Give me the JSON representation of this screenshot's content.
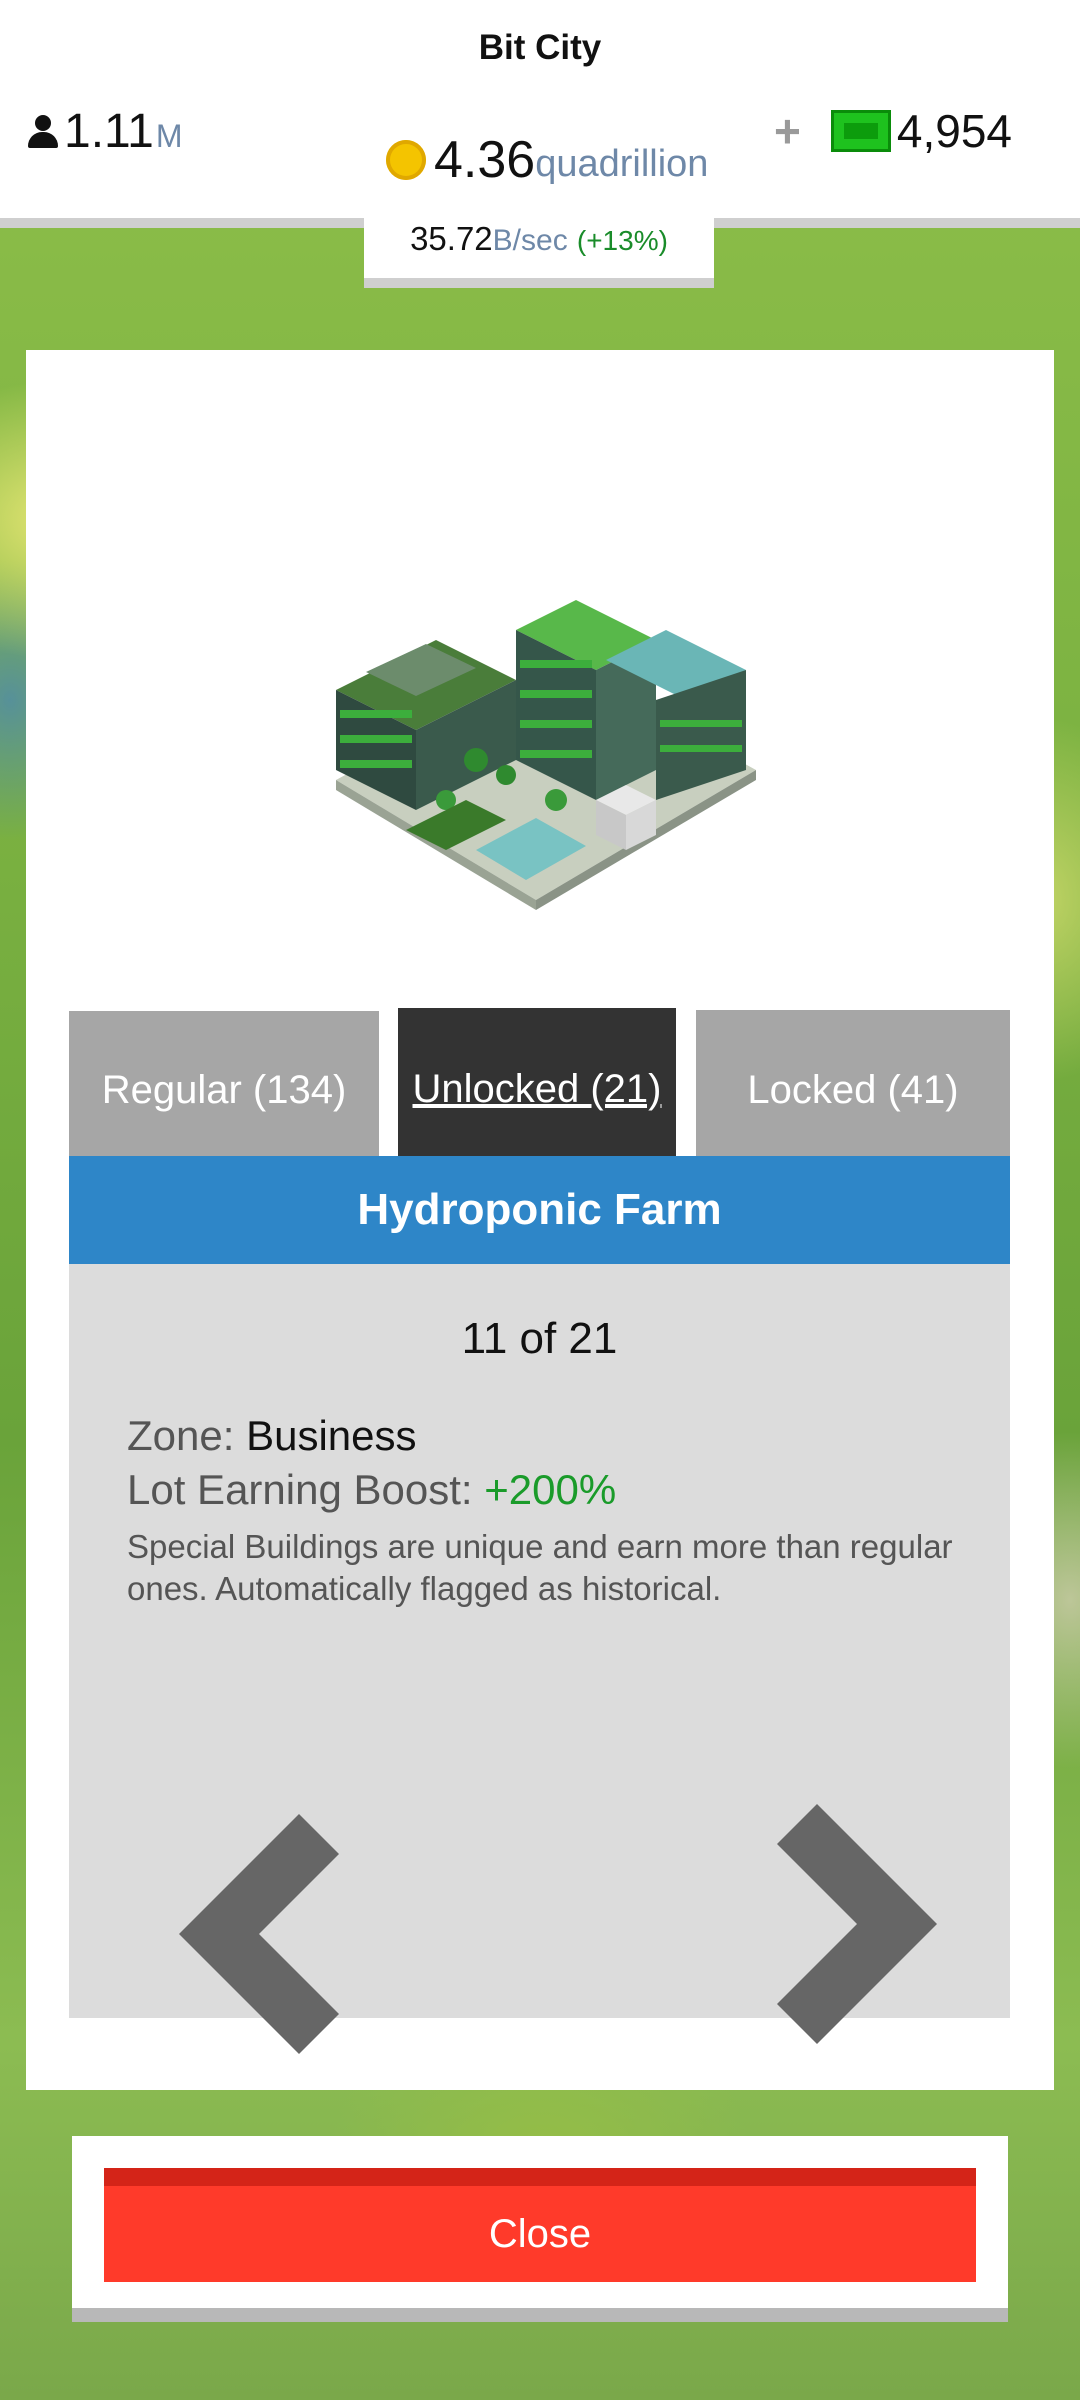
{
  "app": {
    "title": "Bit City"
  },
  "stats": {
    "population_value": "1.11",
    "population_unit": "M",
    "coins_value": "4.36",
    "coins_unit": "quadrillion",
    "rate_value": "35.72",
    "rate_unit": "B/sec",
    "rate_change": "(+13%)",
    "add_cash_label": "+",
    "cash_value": "4,954"
  },
  "tabs": [
    {
      "label": "Regular (134)",
      "active": false
    },
    {
      "label": "Unlocked (21)",
      "active": true
    },
    {
      "label": "Locked (41)",
      "active": false
    }
  ],
  "building": {
    "name": "Hydroponic Farm",
    "counter": "11 of 21",
    "zone_label": "Zone:",
    "zone_value": "Business",
    "boost_label": "Lot Earning Boost:",
    "boost_value": "+200%",
    "description": "Special Buildings are unique and earn more than regular ones. Automatically flagged as historical."
  },
  "actions": {
    "close_label": "Close"
  },
  "colors": {
    "title_bar": "#2e86c8",
    "active_tab": "#333333",
    "inactive_tab": "#a6a6a6",
    "close_button": "#ff3a2a",
    "boost_green": "#1a9b2a"
  },
  "icons": [
    "person-icon",
    "coin-icon",
    "cash-bill-icon",
    "chevron-left-icon",
    "chevron-right-icon"
  ]
}
